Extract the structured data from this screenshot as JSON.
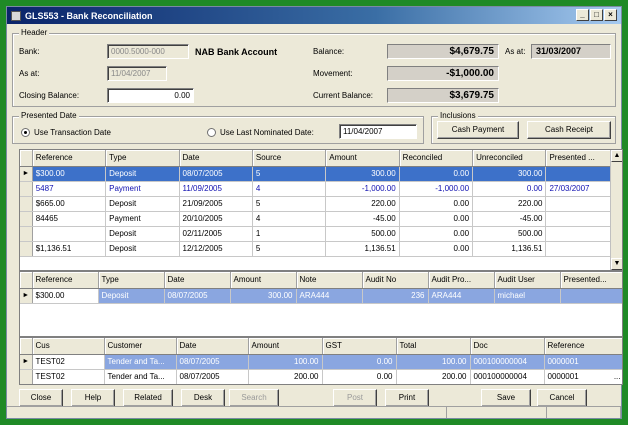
{
  "window": {
    "title": "GLS553 - Bank Reconciliation"
  },
  "header": {
    "group_title": "Header",
    "bank_label": "Bank:",
    "bank_code": "0000.5000-000",
    "bank_name": "NAB Bank Account",
    "asat_label": "As at:",
    "asat_value": "11/04/2007",
    "closing_label": "Closing Balance:",
    "closing_value": "0.00",
    "balance_label": "Balance:",
    "balance_value": "$4,679.75",
    "balance_asat_label": "As at:",
    "balance_asat_value": "31/03/2007",
    "movement_label": "Movement:",
    "movement_value": "-$1,000.00",
    "current_label": "Current Balance:",
    "current_value": "$3,679.75"
  },
  "presented": {
    "group_title": "Presented Date",
    "opt1": "Use Transaction Date",
    "opt2": "Use Last Nominated Date:",
    "date_value": "11/04/2007"
  },
  "inclusions": {
    "group_title": "Inclusions",
    "cash_payment": "Cash Payment",
    "cash_receipt": "Cash Receipt"
  },
  "grid1": {
    "columns": [
      "Reference",
      "Type",
      "Date",
      "Source",
      "Amount",
      "Reconciled",
      "Unreconciled",
      "Presented ..."
    ],
    "rows": [
      [
        "$300.00",
        "Deposit",
        "08/07/2005",
        "5",
        "300.00",
        "0.00",
        "300.00",
        ""
      ],
      [
        "5487",
        "Payment",
        "11/09/2005",
        "4",
        "-1,000.00",
        "-1,000.00",
        "0.00",
        "27/03/2007"
      ],
      [
        "$665.00",
        "Deposit",
        "21/09/2005",
        "5",
        "220.00",
        "0.00",
        "220.00",
        ""
      ],
      [
        "84465",
        "Payment",
        "20/10/2005",
        "4",
        "-45.00",
        "0.00",
        "-45.00",
        ""
      ],
      [
        "",
        "Deposit",
        "02/11/2005",
        "1",
        "500.00",
        "0.00",
        "500.00",
        ""
      ],
      [
        "$1,136.51",
        "Deposit",
        "12/12/2005",
        "5",
        "1,136.51",
        "0.00",
        "1,136.51",
        ""
      ]
    ]
  },
  "grid2": {
    "columns": [
      "Reference",
      "Type",
      "Date",
      "Amount",
      "Note",
      "Audit No",
      "Audit Pro...",
      "Audit User",
      "Presented..."
    ],
    "rows": [
      [
        "$300.00",
        "Deposit",
        "08/07/2005",
        "300.00",
        "ARA444",
        "236",
        "ARA444",
        "michael",
        ""
      ]
    ]
  },
  "grid3": {
    "columns": [
      "Cus",
      "Customer",
      "Date",
      "Amount",
      "GST",
      "Total",
      "Doc",
      "Reference"
    ],
    "rows": [
      [
        "TEST02",
        "Tender and Ta...",
        "08/07/2005",
        "100.00",
        "0.00",
        "100.00",
        "000100000004",
        "0000001"
      ],
      [
        "TEST02",
        "Tender and Ta...",
        "08/07/2005",
        "200.00",
        "0.00",
        "200.00",
        "000100000004",
        "0000001"
      ]
    ]
  },
  "buttons": {
    "close": "Close",
    "help": "Help",
    "related": "Related",
    "desk": "Desk",
    "search": "Search",
    "post": "Post",
    "print": "Print",
    "save": "Save",
    "cancel": "Cancel"
  },
  "ellipsis": "..."
}
